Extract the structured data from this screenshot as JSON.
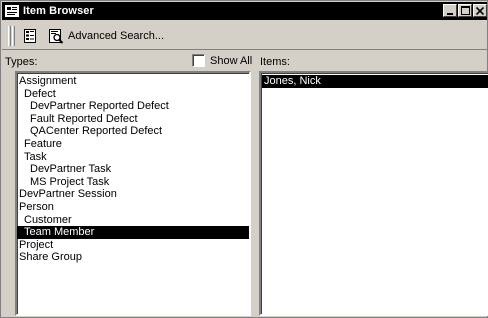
{
  "window": {
    "title": "Item Browser"
  },
  "toolbar": {
    "view_icon": "view-toggle-icon",
    "advanced_search_icon": "search-document-icon",
    "advanced_search_label": "Advanced Search..."
  },
  "types": {
    "label": "Types:",
    "show_all_label": "Show All",
    "show_all_checked": false,
    "items": [
      {
        "label": "Assignment",
        "level": 0,
        "selected": false
      },
      {
        "label": "Defect",
        "level": 1,
        "selected": false
      },
      {
        "label": "DevPartner Reported Defect",
        "level": 2,
        "selected": false
      },
      {
        "label": "Fault Reported Defect",
        "level": 2,
        "selected": false
      },
      {
        "label": "QACenter Reported Defect",
        "level": 2,
        "selected": false
      },
      {
        "label": "Feature",
        "level": 1,
        "selected": false
      },
      {
        "label": "Task",
        "level": 1,
        "selected": false
      },
      {
        "label": "DevPartner Task",
        "level": 2,
        "selected": false
      },
      {
        "label": "MS Project Task",
        "level": 2,
        "selected": false
      },
      {
        "label": "DevPartner Session",
        "level": 0,
        "selected": false
      },
      {
        "label": "Person",
        "level": 0,
        "selected": false
      },
      {
        "label": "Customer",
        "level": 1,
        "selected": false
      },
      {
        "label": "Team Member",
        "level": 1,
        "selected": true
      },
      {
        "label": "Project",
        "level": 0,
        "selected": false
      },
      {
        "label": "Share Group",
        "level": 0,
        "selected": false
      }
    ]
  },
  "items": {
    "label": "Items:",
    "rows": [
      {
        "label": "Jones, Nick",
        "selected": true
      }
    ]
  },
  "colors": {
    "window_face": "#d4d0c8",
    "titlebar": "#000000",
    "selection": "#000000",
    "selection_text": "#ffffff"
  }
}
